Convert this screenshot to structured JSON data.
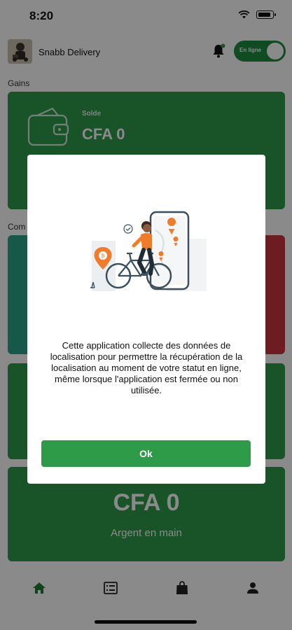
{
  "status_bar": {
    "time": "8:20"
  },
  "header": {
    "app_title": "Snabb Delivery",
    "toggle_label": "En ligne"
  },
  "gains": {
    "section_label": "Gains",
    "solde_label": "Solde",
    "solde_value": "CFA 0"
  },
  "commandes": {
    "section_label": "Com"
  },
  "cash": {
    "amount": "CFA 0",
    "label": "Argent en main"
  },
  "dialog": {
    "message": "Cette application collecte des données de localisation pour permettre la récupération de la localisation au moment de votre statut en ligne, même lorsque l'application est fermée ou non utilisée.",
    "ok_label": "Ok"
  },
  "colors": {
    "primary_green": "#2e9b49",
    "teal": "#2aa58a",
    "red": "#c9343e",
    "accent_orange": "#f07b2a"
  },
  "icons": {
    "wifi": "wifi-icon",
    "battery": "battery-icon",
    "bell": "bell-icon",
    "wallet": "wallet-icon",
    "home": "home-icon",
    "list": "list-icon",
    "bag": "bag-icon",
    "profile": "person-icon"
  }
}
